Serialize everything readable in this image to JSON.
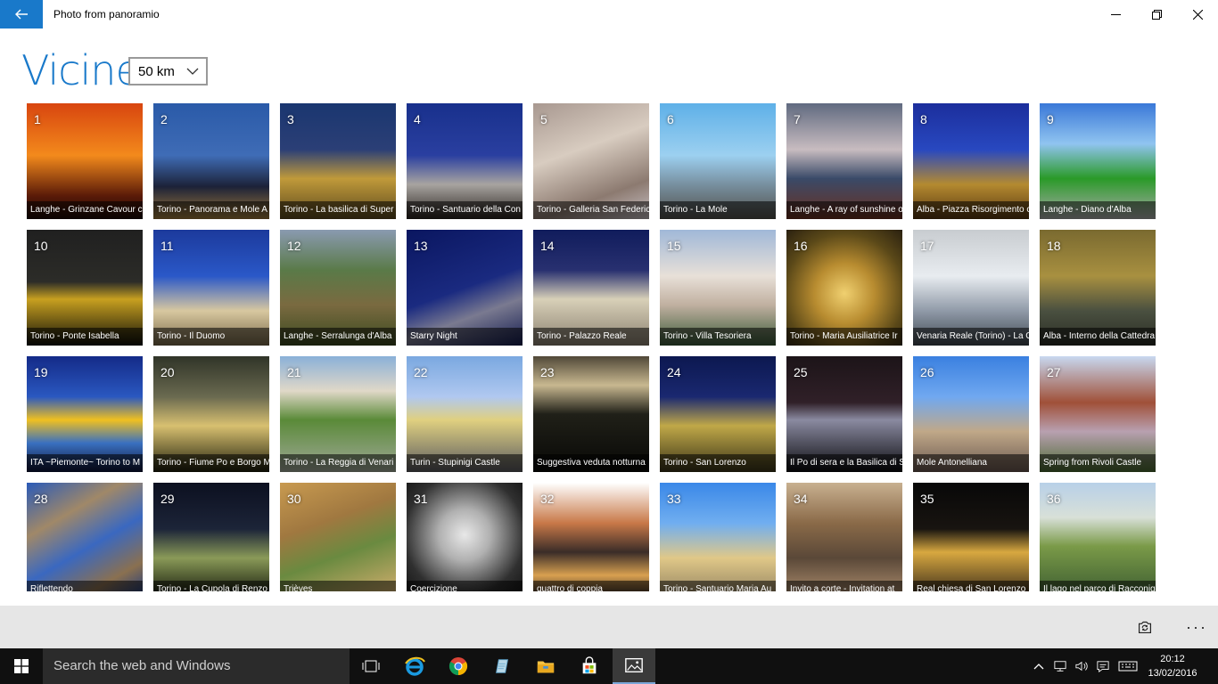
{
  "window": {
    "title": "Photo from panoramio"
  },
  "header": {
    "title": "Vicine",
    "distance": "50 km"
  },
  "photos": [
    {
      "num": "1",
      "caption": "Langhe - Grinzane Cavour c",
      "bg": "linear-gradient(180deg,#d8450f 0%,#f38a1c 45%,#5a1a08 80%,#1c0a04 100%)"
    },
    {
      "num": "2",
      "caption": "Torino - Panorama e Mole A",
      "bg": "linear-gradient(180deg,#2a5aa8 0%,#3f6cb6 45%,#1c2238 72%,#a07a3a 100%)"
    },
    {
      "num": "3",
      "caption": "Torino - La basilica di Super",
      "bg": "linear-gradient(180deg,#1a3670 0%,#2b3f76 40%,#c09a3a 65%,#5e4a1e 100%)"
    },
    {
      "num": "4",
      "caption": "Torino - Santuario della Con",
      "bg": "linear-gradient(180deg,#18308c 0%,#2a3fa0 45%,#a8a4a0 70%,#2a2420 100%)"
    },
    {
      "num": "5",
      "caption": "Torino - Galleria San Federic",
      "bg": "linear-gradient(160deg,#a89890 0%,#d8ccc0 40%,#8c7a70 75%,#c8c0c4 100%)"
    },
    {
      "num": "6",
      "caption": "Torino - La Mole",
      "bg": "linear-gradient(180deg,#5eb0e8 0%,#9cd0f0 45%,#7890a0 70%,#50504a 100%)"
    },
    {
      "num": "7",
      "caption": "Langhe - A ray of sunshine o",
      "bg": "linear-gradient(180deg,#606a80 0%,#c8bcc0 40%,#3a4a68 65%,#6a3020 100%)"
    },
    {
      "num": "8",
      "caption": "Alba - Piazza Risorgimento c",
      "bg": "linear-gradient(180deg,#1c2e9c 0%,#2848c0 40%,#b48a30 70%,#5a3810 100%)"
    },
    {
      "num": "9",
      "caption": "Langhe - Diano d'Alba",
      "bg": "linear-gradient(180deg,#3a78d8 0%,#90c4f0 35%,#2a9a28 65%,#a8a8a8 100%)"
    },
    {
      "num": "10",
      "caption": "Torino - Ponte Isabella",
      "bg": "linear-gradient(180deg,#202020 0%,#2c2c28 45%,#c8a020 60%,#101008 100%)"
    },
    {
      "num": "11",
      "caption": "Torino - Il Duomo",
      "bg": "linear-gradient(180deg,#1c3a9c 0%,#2a58c8 40%,#d8c8a0 70%,#786848 100%)"
    },
    {
      "num": "12",
      "caption": "Langhe - Serralunga d'Alba",
      "bg": "linear-gradient(180deg,#8a9ab0 0%,#5a7a48 35%,#7a6a40 65%,#3a4a20 100%)"
    },
    {
      "num": "13",
      "caption": "Starry Night",
      "bg": "linear-gradient(160deg,#0a1660 0%,#1a2a80 50%,#7a7a90 70%,#141c50 100%)"
    },
    {
      "num": "14",
      "caption": "Torino - Palazzo Reale",
      "bg": "linear-gradient(180deg,#101c5c 0%,#283070 35%,#d8d0b8 60%,#8a8070 100%)"
    },
    {
      "num": "15",
      "caption": "Torino - Villa Tesoriera",
      "bg": "linear-gradient(180deg,#a0b8d8 0%,#e8e0d8 40%,#c0b0a0 65%,#3a5a38 100%)"
    },
    {
      "num": "16",
      "caption": "Torino - Maria Ausiliatrice Ir",
      "bg": "radial-gradient(circle at 50% 55%,#f0d070 0%,#b88c30 35%,#5a4818 70%,#2a2010 100%)"
    },
    {
      "num": "17",
      "caption": "Venaria Reale (Torino) - La G",
      "bg": "linear-gradient(180deg,#c8ccd0 0%,#e8ecf0 40%,#909aa8 70%,#404850 100%)"
    },
    {
      "num": "18",
      "caption": "Alba - Interno della Cattedra",
      "bg": "linear-gradient(180deg,#7a6a30 0%,#a89040 40%,#4a5040 70%,#2a2c24 100%)"
    },
    {
      "num": "19",
      "caption": "ITA ~Piemonte~ Torino to M",
      "bg": "linear-gradient(180deg,#142a88 0%,#2a58c0 35%,#f0c020 55%,#3a70c0 75%,#0c1438 100%)"
    },
    {
      "num": "20",
      "caption": "Torino - Fiume Po e Borgo M",
      "bg": "linear-gradient(180deg,#303428 0%,#6a6a50 35%,#d8c070 60%,#20200c 100%)"
    },
    {
      "num": "21",
      "caption": "Torino - La Reggia di Venari",
      "bg": "linear-gradient(180deg,#8ab0d8 0%,#e0d8c8 30%,#5a8a38 55%,#a0a898 100%)"
    },
    {
      "num": "22",
      "caption": "Turin - Stupinigi Castle",
      "bg": "linear-gradient(180deg,#7aa8e0 0%,#b0c8f0 35%,#e0d080 55%,#5a5a60 100%)"
    },
    {
      "num": "23",
      "caption": "Suggestiva veduta notturna",
      "bg": "linear-gradient(180deg,#504838 0%,#c8b890 25%,#202018 50%,#080806 100%)"
    },
    {
      "num": "24",
      "caption": "Torino - San Lorenzo",
      "bg": "linear-gradient(180deg,#0c1850 0%,#1a2870 35%,#c0a848 60%,#3a3418 100%)"
    },
    {
      "num": "25",
      "caption": "Il Po di sera e la Basilica di S",
      "bg": "linear-gradient(180deg,#1c1418 0%,#302028 40%,#8a8aa0 55%,#0c0c10 100%)"
    },
    {
      "num": "26",
      "caption": "Mole Antonelliana",
      "bg": "linear-gradient(180deg,#3a80e0 0%,#70a8f0 35%,#c0a888 65%,#6a5850 100%)"
    },
    {
      "num": "27",
      "caption": "Spring from Rivoli Castle",
      "bg": "linear-gradient(180deg,#c8d8f0 0%,#a05038 40%,#b8a0b0 65%,#4a6a30 100%)"
    },
    {
      "num": "28",
      "caption": "Riflettendo",
      "bg": "linear-gradient(150deg,#2a5ab8 0%,#a08868 30%,#3a68c0 55%,#8a7050 80%,#1a3880 100%)"
    },
    {
      "num": "29",
      "caption": "Torino - La Cupola di Renzo",
      "bg": "linear-gradient(180deg,#0c1020 0%,#1c2438 40%,#8a9a58 65%,#101408 100%)"
    },
    {
      "num": "30",
      "caption": "Trièves",
      "bg": "linear-gradient(160deg,#c89a50 0%,#a07840 35%,#6a8a40 60%,#d8b070 100%)"
    },
    {
      "num": "31",
      "caption": "Coercizione",
      "bg": "radial-gradient(circle at 50% 45%,#e8e8e8 0%,#b0b0b0 30%,#303030 70%,#101010 100%)"
    },
    {
      "num": "32",
      "caption": "quattro di coppia",
      "bg": "linear-gradient(180deg,#ffffff 0%,#c87848 35%,#3a2c28 60%,#d8a050 80%,#2a2020 100%)"
    },
    {
      "num": "33",
      "caption": "Torino - Santuario Maria Au",
      "bg": "linear-gradient(180deg,#3a88e8 0%,#70aef0 35%,#e0c888 65%,#908060 100%)"
    },
    {
      "num": "34",
      "caption": "Invito a corte - Invitation at",
      "bg": "linear-gradient(180deg,#c8b090 0%,#8a6a48 35%,#5a4838 65%,#b09070 100%)"
    },
    {
      "num": "35",
      "caption": "Real chiesa di San Lorenzo",
      "bg": "linear-gradient(180deg,#080808 0%,#181410 40%,#d8a840 60%,#302418 100%)"
    },
    {
      "num": "36",
      "caption": "Il lago nel parco di Racconig",
      "bg": "linear-gradient(180deg,#b8d0e8 0%,#d8e0d8 30%,#7a9a48 55%,#3a5a30 100%)"
    }
  ],
  "appbar": {
    "more": "···"
  },
  "taskbar": {
    "search_placeholder": "Search the web and Windows",
    "time": "20:12",
    "date": "13/02/2016"
  },
  "colors": {
    "accent": "#1979ca",
    "taskbar": "#101010",
    "appbar": "#e6e6e6"
  }
}
